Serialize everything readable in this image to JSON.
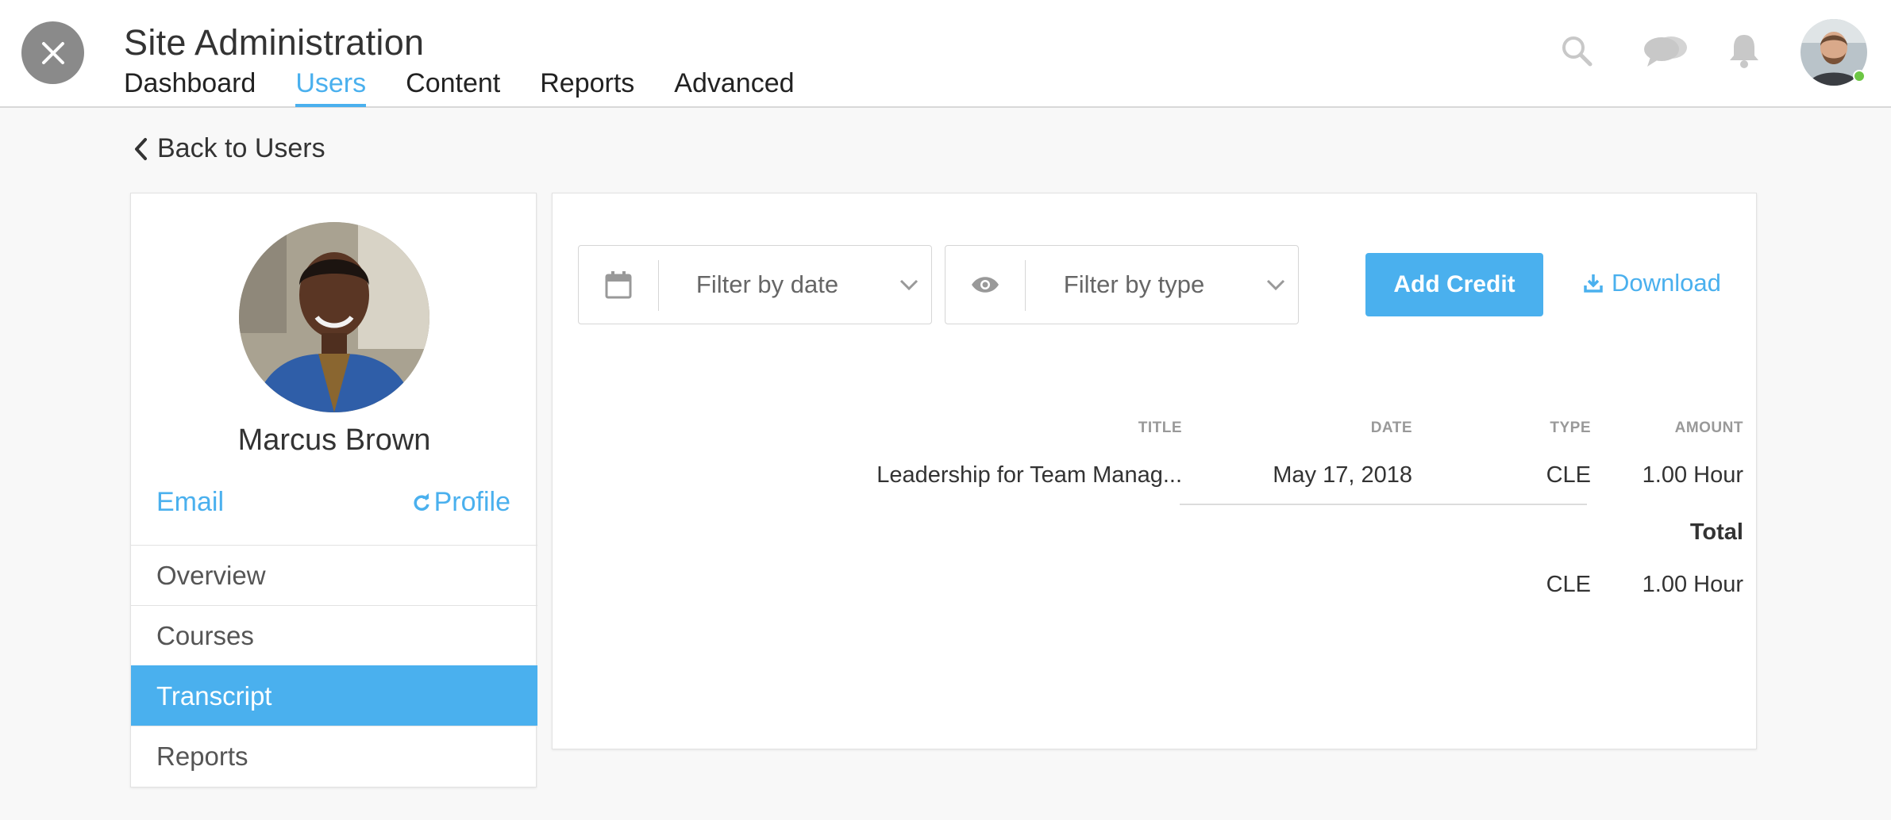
{
  "header": {
    "title": "Site Administration",
    "nav": [
      "Dashboard",
      "Users",
      "Content",
      "Reports",
      "Advanced"
    ],
    "active_nav": "Users",
    "icons": [
      "search-icon",
      "chat-icon",
      "bell-icon"
    ]
  },
  "back_label": "Back to Users",
  "user": {
    "name": "Marcus Brown",
    "email_label": "Email",
    "profile_label": "Profile"
  },
  "side_menu": [
    "Overview",
    "Courses",
    "Transcript",
    "Reports"
  ],
  "active_side_item": "Transcript",
  "filters": {
    "date_placeholder": "Filter by date",
    "type_placeholder": "Filter by type"
  },
  "actions": {
    "add_credit": "Add Credit",
    "download": "Download"
  },
  "table": {
    "headers": [
      "TITLE",
      "DATE",
      "TYPE",
      "AMOUNT"
    ],
    "rows": [
      {
        "title": "Leadership for Team Manag...",
        "date": "May 17, 2018",
        "type": "CLE",
        "amount": "1.00 Hour"
      }
    ],
    "total_label": "Total",
    "totals": [
      {
        "type": "CLE",
        "amount": "1.00 Hour"
      }
    ]
  },
  "colors": {
    "accent": "#4ab0ee",
    "online": "#6cc644"
  }
}
